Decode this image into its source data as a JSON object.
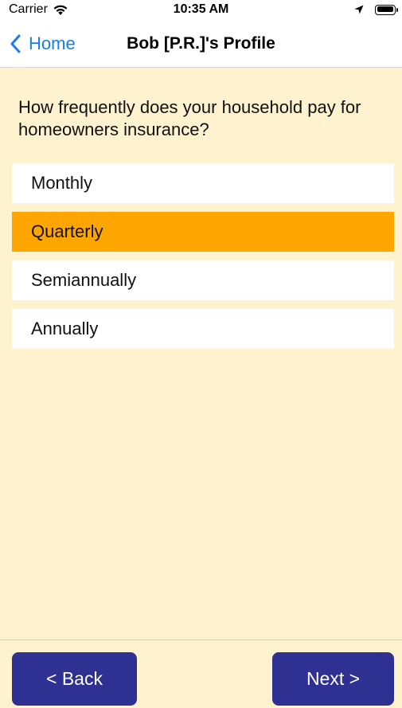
{
  "status_bar": {
    "carrier": "Carrier",
    "time": "10:35 AM"
  },
  "nav": {
    "back_label": "Home",
    "title": "Bob [P.R.]'s Profile",
    "accent_color": "#1a7cf2"
  },
  "question": {
    "text": "How frequently does your household pay for homeowners insurance?"
  },
  "options": [
    {
      "label": "Monthly",
      "selected": false
    },
    {
      "label": "Quarterly",
      "selected": true
    },
    {
      "label": "Semiannually",
      "selected": false
    },
    {
      "label": "Annually",
      "selected": false
    }
  ],
  "footer": {
    "back_label": "< Back",
    "next_label": "Next >",
    "button_color": "#2E3192"
  },
  "colors": {
    "background": "#FFF2CF",
    "selected_option": "#FFA500"
  }
}
